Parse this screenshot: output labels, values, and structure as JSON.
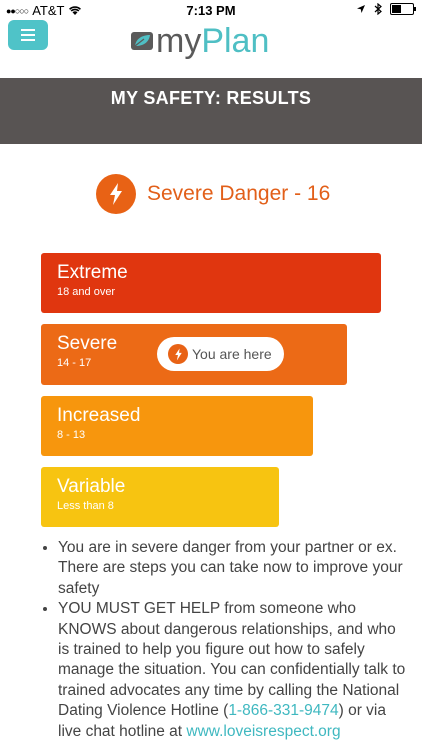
{
  "status_bar": {
    "carrier": "AT&T",
    "time": "7:13 PM",
    "icons": [
      "signal-dots-icon",
      "wifi-icon",
      "location-icon",
      "bluetooth-icon",
      "battery-icon"
    ]
  },
  "header": {
    "menu_icon": "hamburger-menu-icon",
    "logo_my": "my",
    "logo_plan": "Plan",
    "accent_color": "#4fc3c8"
  },
  "page_title": "MY SAFETY: RESULTS",
  "result": {
    "text": "Severe Danger - 16",
    "icon": "lightning-bolt-icon",
    "color": "#e86215"
  },
  "scale": [
    {
      "label": "Extreme",
      "range": "18 and over",
      "color": "#e0360f"
    },
    {
      "label": "Severe",
      "range": "14 - 17",
      "color": "#ec6a16"
    },
    {
      "label": "Increased",
      "range": "8 - 13",
      "color": "#f7960d"
    },
    {
      "label": "Variable",
      "range": "Less than 8",
      "color": "#f7c411"
    }
  ],
  "you_are_here": "You are here",
  "advice": {
    "item1": "You are in severe danger from your partner or ex. There are steps you can take now to improve your safety",
    "item2_text": "YOU MUST GET HELP from someone who KNOWS about dangerous relationships, and who is trained to help you figure out how to safely manage the situation. You can confidentially talk to trained advocates any time by calling the National Dating Violence Hotline (",
    "hotline_number": "1-866-331-9474",
    "item2_after": ") or via live chat hotline at ",
    "chat_link": "www.loveisrespect.org"
  }
}
